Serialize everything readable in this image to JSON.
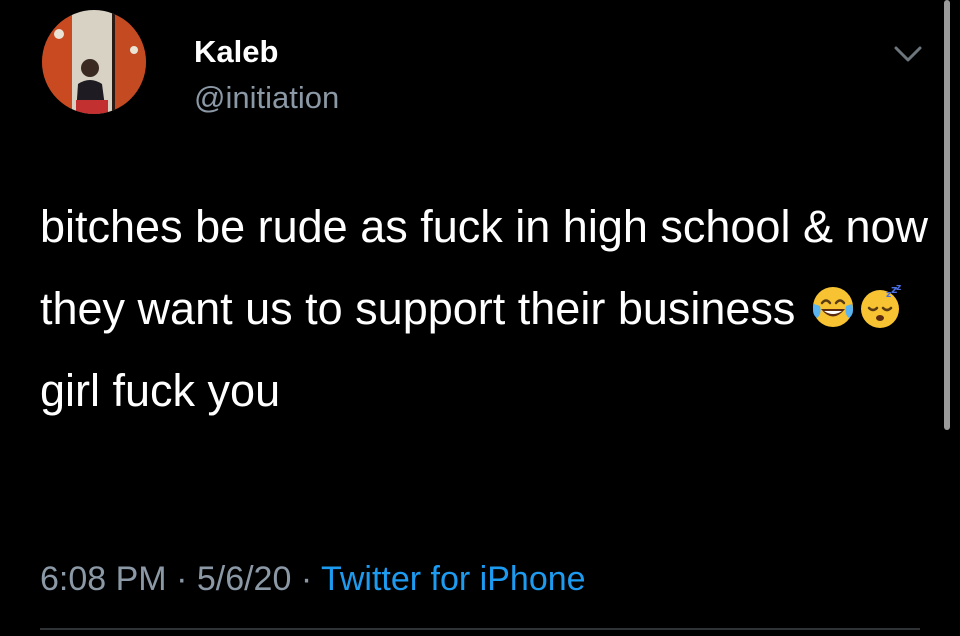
{
  "user": {
    "display_name": "Kaleb",
    "handle": "@initiation",
    "avatar_icon": "profile-photo"
  },
  "tweet": {
    "text_part1": "bitches be rude as fuck in high school & now they want us to support their business ",
    "emoji1": "face-with-tears-of-joy",
    "emoji2": "sleeping-face",
    "text_part2": " girl fuck you"
  },
  "meta": {
    "time": "6:08 PM",
    "sep1": " · ",
    "date": "5/6/20",
    "sep2": " · ",
    "source": "Twitter for iPhone"
  },
  "colors": {
    "background": "#000000",
    "text": "#ffffff",
    "secondary": "#8b98a5",
    "link": "#1d9bf0"
  },
  "icons": {
    "menu": "chevron-down-icon"
  }
}
